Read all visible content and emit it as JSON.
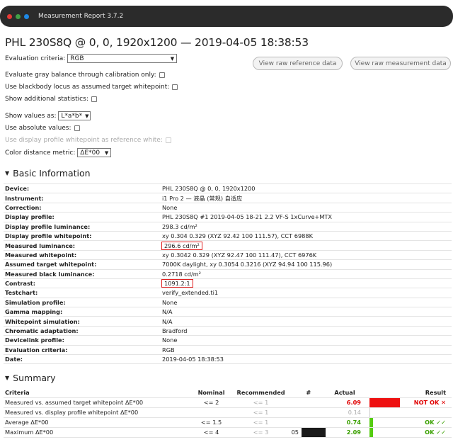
{
  "window": {
    "title": "Measurement Report 3.7.2",
    "dots": [
      "#e53935",
      "#43a047",
      "#1e88e5"
    ]
  },
  "page_title": "PHL 230S8Q @ 0, 0, 1920x1200 — 2019-04-05 18:38:53",
  "options": {
    "evaluation_criteria_label": "Evaluation criteria:",
    "evaluation_criteria_value": "RGB",
    "gray_balance_label": "Evaluate gray balance through calibration only:",
    "blackbody_label": "Use blackbody locus as assumed target whitepoint:",
    "additional_stats_label": "Show additional statistics:",
    "show_values_label": "Show values as:",
    "show_values_value": "L*a*b*",
    "absolute_values_label": "Use absolute values:",
    "display_profile_wp_label": "Use display profile whitepoint as reference white:",
    "color_distance_label": "Color distance metric:",
    "color_distance_value": "ΔE*00"
  },
  "buttons": {
    "raw_reference": "View raw reference data",
    "raw_measurement": "View raw measurement data"
  },
  "basic": {
    "heading": "Basic Information",
    "rows": [
      {
        "k": "Device:",
        "v": "PHL 230S8Q @ 0, 0, 1920x1200"
      },
      {
        "k": "Instrument:",
        "v": "i1 Pro 2 — 液晶 (常规) 自适应"
      },
      {
        "k": "Correction:",
        "v": "None"
      },
      {
        "k": "Display profile:",
        "v": "PHL 230S8Q #1 2019-04-05 18-21 2.2 VF-S 1xCurve+MTX"
      },
      {
        "k": "Display profile luminance:",
        "v": "298.3 cd/m²"
      },
      {
        "k": "Display profile whitepoint:",
        "v": "xy 0.304 0.329 (XYZ 92.42 100 111.57), CCT 6988K"
      },
      {
        "k": "Measured luminance:",
        "v": "296.6 cd/m²"
      },
      {
        "k": "Measured whitepoint:",
        "v": "xy 0.3042 0.329 (XYZ 92.47 100 111.47), CCT 6976K"
      },
      {
        "k": "Assumed target whitepoint:",
        "v": "7000K daylight, xy 0.3054 0.3216 (XYZ 94.94 100 115.96)"
      },
      {
        "k": "Measured black luminance:",
        "v": "0.2718 cd/m²"
      },
      {
        "k": "Contrast:",
        "v": "1091.2:1"
      },
      {
        "k": "Testchart:",
        "v": "verify_extended.ti1"
      },
      {
        "k": "Simulation profile:",
        "v": "None"
      },
      {
        "k": "Gamma mapping:",
        "v": "N/A"
      },
      {
        "k": "Whitepoint simulation:",
        "v": "N/A"
      },
      {
        "k": "Chromatic adaptation:",
        "v": "Bradford"
      },
      {
        "k": "Devicelink profile:",
        "v": "None"
      },
      {
        "k": "Evaluation criteria:",
        "v": "RGB"
      },
      {
        "k": "Date:",
        "v": "2019-04-05 18:38:53"
      }
    ]
  },
  "summary": {
    "heading": "Summary",
    "headers": {
      "criteria": "Criteria",
      "nominal": "Nominal",
      "recommended": "Recommended",
      "num": "#",
      "actual": "Actual",
      "result": "Result"
    },
    "rows": [
      {
        "criteria": "Measured vs. assumed target whitepoint ΔE*00",
        "nominal": "<= 2",
        "recommended": "<= 1",
        "num": "",
        "actual": "6.09",
        "result": "NOT OK ✕",
        "status": "fail",
        "bar_fraction": 0.8,
        "bar_color": "#ee1111"
      },
      {
        "criteria": "Measured vs. display profile whitepoint ΔE*00",
        "nominal": "",
        "recommended": "<= 1",
        "num": "",
        "actual": "0.14",
        "result": "",
        "status": "info",
        "bar_fraction": 0.02,
        "bar_color": "#cccccc"
      },
      {
        "criteria": "Average ΔE*00",
        "nominal": "<= 1.5",
        "recommended": "<= 1",
        "num": "",
        "actual": "0.74",
        "result": "OK ✓✓",
        "status": "ok",
        "bar_fraction": 0.1,
        "bar_color": "#55cc11"
      },
      {
        "criteria": "Maximum ΔE*00",
        "nominal": "<= 4",
        "recommended": "<= 3",
        "num": "05",
        "actual": "2.09",
        "result": "OK ✓✓",
        "status": "ok",
        "bar_fraction": 0.1,
        "bar_color": "#55cc11"
      }
    ]
  },
  "colors": {
    "highlight": "#e02020",
    "fail": "#e00000",
    "ok": "#3aa000"
  }
}
